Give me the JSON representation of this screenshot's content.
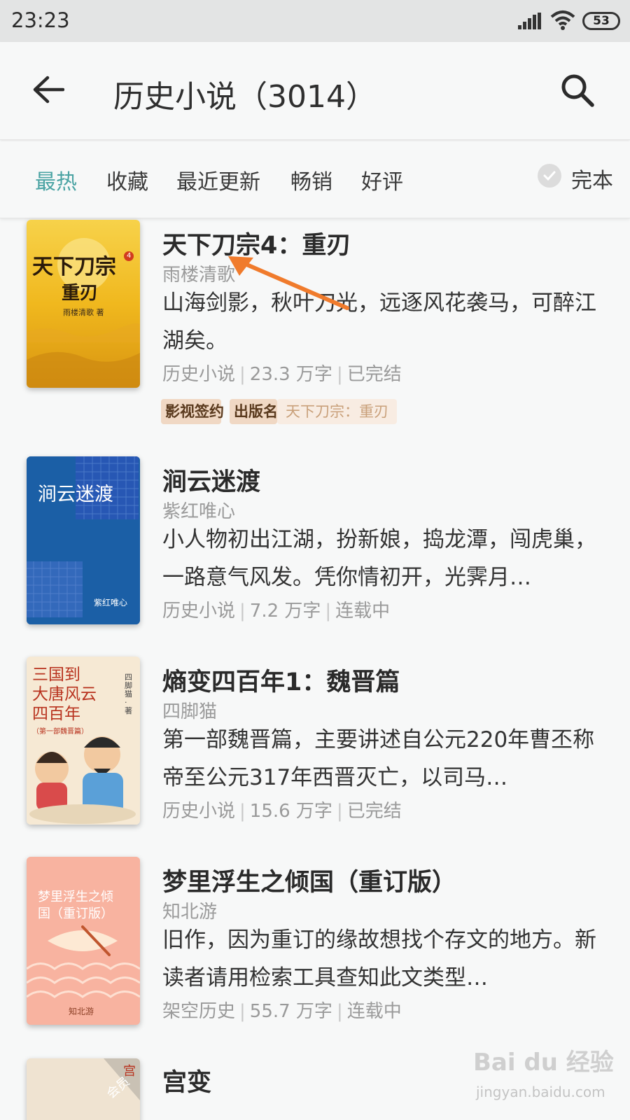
{
  "status_bar": {
    "time": "23:23",
    "battery": "53"
  },
  "header": {
    "title": "历史小说（3014）"
  },
  "filters": {
    "tabs": [
      {
        "label": "最热",
        "active": true
      },
      {
        "label": "收藏",
        "active": false
      },
      {
        "label": "最近更新",
        "active": false
      },
      {
        "label": "畅销",
        "active": false
      },
      {
        "label": "好评",
        "active": false
      }
    ],
    "complete_label": "完本"
  },
  "books": [
    {
      "title": "天下刀宗4：重刃",
      "author": "雨楼清歌",
      "desc": "山海剑影，秋叶刀光，远逐风花袭马，可醉江湖矣。",
      "category": "历史小说",
      "words": "23.3 万字",
      "status": "已完结",
      "tags": {
        "film": "影视签约",
        "publish": "出版名",
        "publish_name": "天下刀宗：重刃"
      },
      "cover": {
        "title": "天下刀宗",
        "subtitle": "重刃",
        "author": "雨楼清歌 著",
        "badge": "4"
      }
    },
    {
      "title": "涧云迷渡",
      "author": "紫红唯心",
      "desc": "小人物初出江湖，扮新娘，捣龙潭，闯虎巢，一路意气风发。凭你情初开，光霁月…",
      "category": "历史小说",
      "words": "7.2 万字",
      "status": "连载中",
      "cover": {
        "title": "涧云迷渡",
        "author": "紫红唯心"
      }
    },
    {
      "title": "熵变四百年1：魏晋篇",
      "author": "四脚猫",
      "desc": "第一部魏晋篇，主要讲述自公元220年曹丕称帝至公元317年西晋灭亡，以司马…",
      "category": "历史小说",
      "words": "15.6 万字",
      "status": "已完结",
      "cover": {
        "line1": "三国到",
        "line2": "大唐风云",
        "line3": "四百年",
        "sub": "（第一部魏晋篇）",
        "author": "四脚猫·著"
      }
    },
    {
      "title": "梦里浮生之倾国（重订版）",
      "author": "知北游",
      "desc": "旧作，因为重订的缘故想找个存文的地方。新读者请用检索工具查知此文类型…",
      "category": "架空历史",
      "words": "55.7 万字",
      "status": "连载中",
      "cover": {
        "line1": "梦里浮生之倾",
        "line2": "国（重订版）",
        "author": "知北游"
      }
    },
    {
      "title": "宫变",
      "cover": {
        "text1": "宫",
        "text2": "会员"
      }
    }
  ],
  "watermark": {
    "logo": "Bai du 经验",
    "url": "jingyan.baidu.com"
  },
  "colors": {
    "accent": "#4aa3a3",
    "arrow": "#f07b2c"
  }
}
